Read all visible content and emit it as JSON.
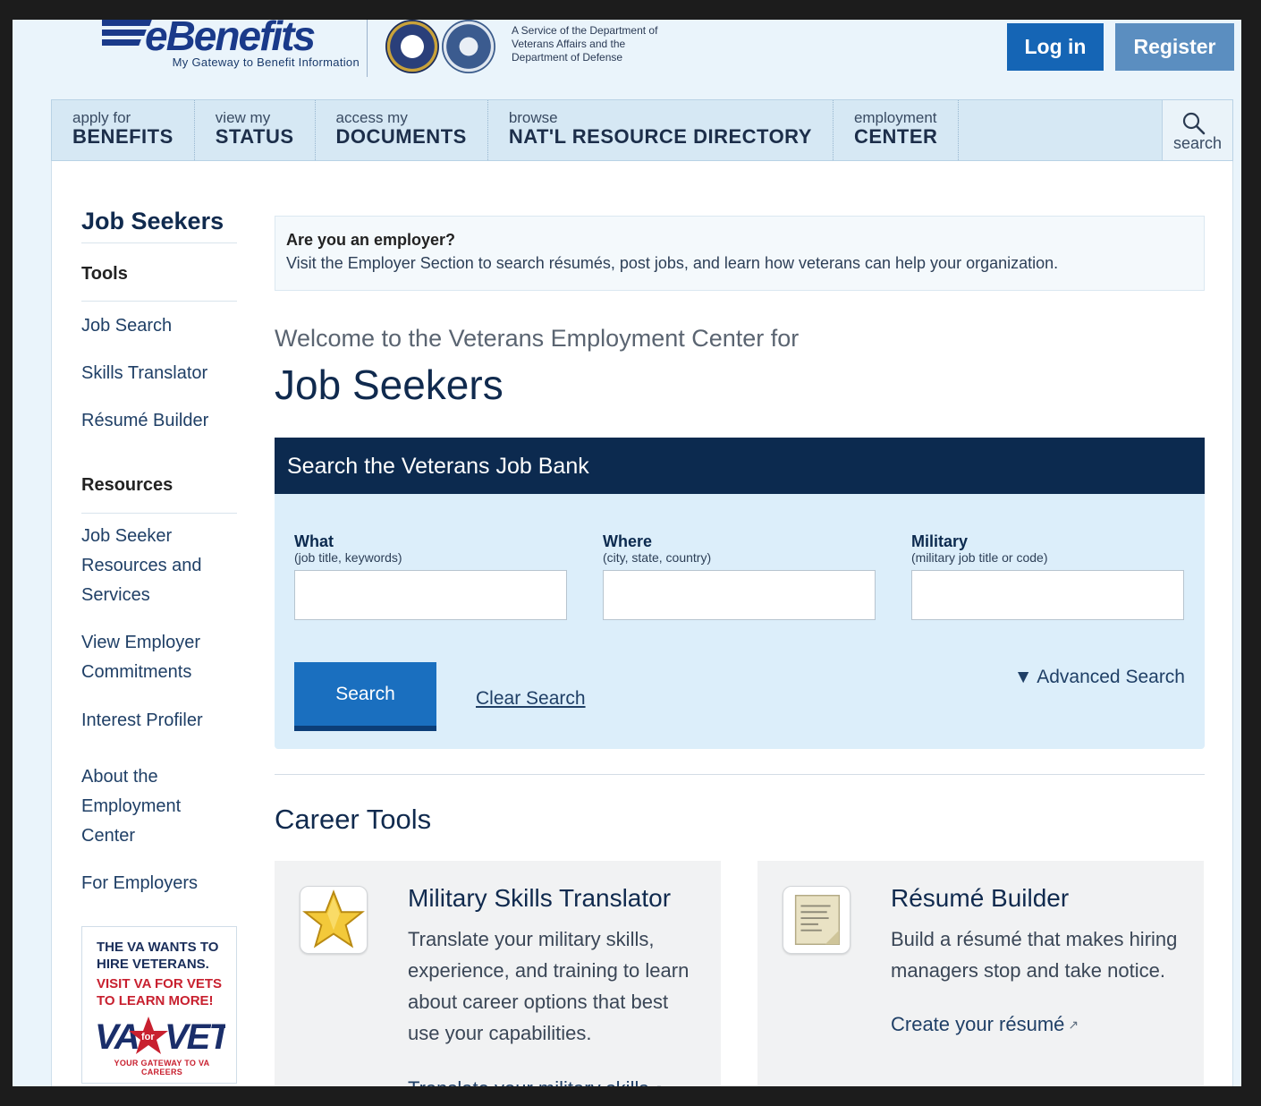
{
  "header": {
    "logo_text": "eBenefits",
    "tagline": "My Gateway to Benefit Information",
    "service_text": "A Service of the Department of Veterans Affairs and the Department of Defense",
    "login_label": "Log in",
    "register_label": "Register"
  },
  "nav": {
    "items": [
      {
        "small": "apply for",
        "large": "BENEFITS"
      },
      {
        "small": "view my",
        "large": "STATUS"
      },
      {
        "small": "access my",
        "large": "DOCUMENTS"
      },
      {
        "small": "browse",
        "large": "NAT'L RESOURCE DIRECTORY"
      },
      {
        "small": "employment",
        "large": "CENTER"
      }
    ],
    "search_label": "search"
  },
  "sidebar": {
    "title": "Job Seekers",
    "tools_heading": "Tools",
    "tools": [
      "Job Search",
      "Skills Translator",
      "Résumé Builder"
    ],
    "resources_heading": "Resources",
    "resources": [
      "Job Seeker Resources and Services",
      "View Employer Commitments",
      "Interest Profiler",
      "About the Employment Center",
      "For Employers"
    ],
    "ad": {
      "line1": "THE VA WANTS TO HIRE VETERANS.",
      "line2": "VISIT VA FOR VETS TO LEARN MORE!",
      "logo_text": "VAforVETS",
      "gateway": "YOUR GATEWAY TO VA CAREERS"
    }
  },
  "employer_box": {
    "question": "Are you an employer?",
    "text": "Visit the Employer Section to search résumés, post jobs, and learn how veterans can help your organization."
  },
  "main": {
    "welcome": "Welcome to the Veterans Employment Center for",
    "title": "Job Seekers"
  },
  "job_bank": {
    "heading": "Search the Veterans Job Bank",
    "fields": [
      {
        "label": "What",
        "hint": "(job title, keywords)",
        "value": ""
      },
      {
        "label": "Where",
        "hint": "(city, state, country)",
        "value": ""
      },
      {
        "label": "Military",
        "hint": "(military job title or code)",
        "value": ""
      }
    ],
    "search_label": "Search",
    "clear_label": "Clear Search",
    "advanced_label": "▼ Advanced Search"
  },
  "career_tools": {
    "heading": "Career Tools",
    "cards": [
      {
        "icon": "star-icon",
        "title": "Military Skills Translator",
        "text": "Translate your military skills, experience, and training to learn about career options that best use your capabilities.",
        "link": "Translate your military skills"
      },
      {
        "icon": "document-icon",
        "title": "Résumé Builder",
        "text": "Build a résumé that makes hiring managers stop and take notice.",
        "link": "Create your résumé"
      }
    ]
  }
}
